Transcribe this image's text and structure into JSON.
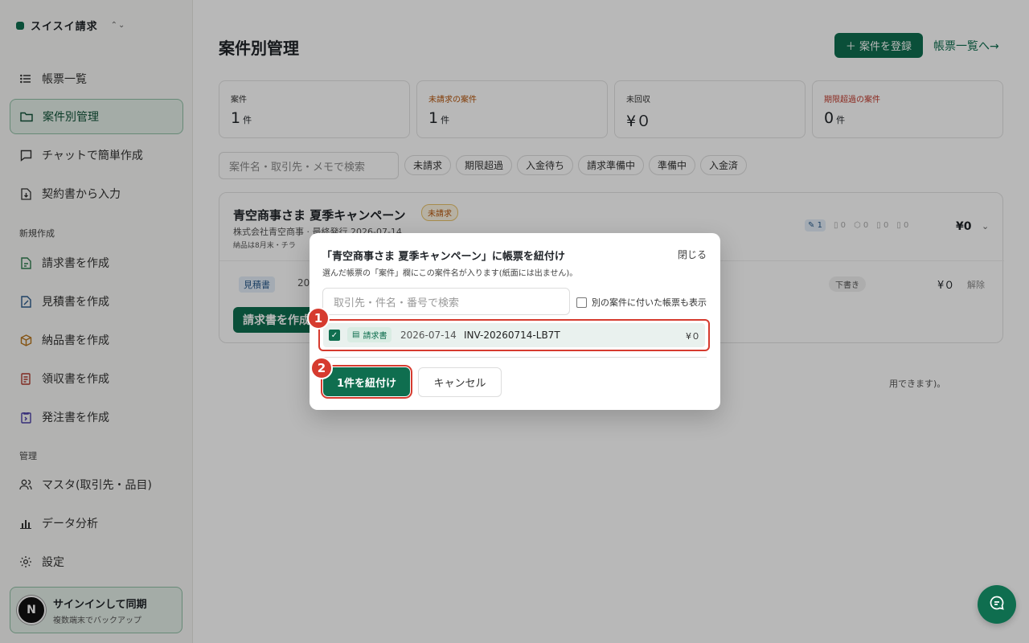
{
  "app": {
    "name": "スイスイ請求",
    "switch_icon": "chevron-updown-icon"
  },
  "sidebar": {
    "nav": [
      {
        "label": "帳票一覧",
        "icon": "list-icon"
      },
      {
        "label": "案件別管理",
        "icon": "folder-icon",
        "active": true
      },
      {
        "label": "チャットで簡単作成",
        "icon": "chat-icon"
      },
      {
        "label": "契約書から入力",
        "icon": "file-import-icon"
      }
    ],
    "section_new": "新規作成",
    "create": [
      {
        "label": "請求書を作成",
        "icon": "invoice-icon",
        "color": "#2e7d4f"
      },
      {
        "label": "見積書を作成",
        "icon": "quote-icon",
        "color": "#2a5b8c"
      },
      {
        "label": "納品書を作成",
        "icon": "box-icon",
        "color": "#b8741a"
      },
      {
        "label": "領収書を作成",
        "icon": "receipt-icon",
        "color": "#b03a2e"
      },
      {
        "label": "発注書を作成",
        "icon": "order-icon",
        "color": "#4b3fa8"
      }
    ],
    "section_manage": "管理",
    "manage": [
      {
        "label": "マスタ(取引先・品目)",
        "icon": "users-icon"
      },
      {
        "label": "データ分析",
        "icon": "bar-chart-icon"
      },
      {
        "label": "設定",
        "icon": "gear-icon"
      }
    ],
    "signin": {
      "avatar": "N",
      "title": "サインインして同期",
      "subtitle": "複数端末でバックアップ"
    }
  },
  "header": {
    "title": "案件別管理",
    "add_button": "＋ 案件を登録",
    "list_link": "帳票一覧へ→"
  },
  "stats": [
    {
      "label": "案件",
      "value": "1",
      "unit": "件",
      "tone": "normal"
    },
    {
      "label": "未請求の案件",
      "value": "1",
      "unit": "件",
      "tone": "warn"
    },
    {
      "label": "未回収",
      "value": "¥０",
      "unit": "",
      "tone": "normal"
    },
    {
      "label": "期限超過の案件",
      "value": "0",
      "unit": "件",
      "tone": "danger"
    }
  ],
  "filters": {
    "search_placeholder": "案件名・取引先・メモで検索",
    "chips": [
      "未請求",
      "期限超過",
      "入金待ち",
      "請求準備中",
      "準備中",
      "入金済"
    ]
  },
  "project": {
    "title": "青空商事さま 夏季キャンペーン",
    "badge": "未請求",
    "meta": "株式会社青空商事 · 最終発行 2026-07-14",
    "note": "納品は8月末・チラ",
    "doc_counts": [
      "1",
      "0",
      "0",
      "0",
      "0"
    ],
    "total": "¥0",
    "row": {
      "type": "見積書",
      "date": "20",
      "status": "下書き",
      "amount": "¥０",
      "action": "解除"
    },
    "create_button": "請求書を作成"
  },
  "hint_text": "用できます)。",
  "dialog": {
    "title": "「青空商事さま 夏季キャンペーン」に帳票を紐付け",
    "close": "閉じる",
    "subtitle": "選んだ帳票の「案件」欄にこの案件名が入ります(紙面には出ません)。",
    "search_placeholder": "取引先・件名・番号で検索",
    "show_other_label": "別の案件に付いた帳票も表示",
    "invoice": {
      "checked": true,
      "type": "請求書",
      "date": "2026-07-14",
      "number": "INV-20260714-LB7T",
      "amount": "¥０"
    },
    "confirm_button": "1件を紐付け",
    "cancel_button": "キャンセル"
  },
  "markers": [
    "1",
    "2"
  ],
  "colors": {
    "accent": "#0f6e4f",
    "highlight": "#d63b2f",
    "warn": "#b45309",
    "danger": "#c0392b"
  }
}
